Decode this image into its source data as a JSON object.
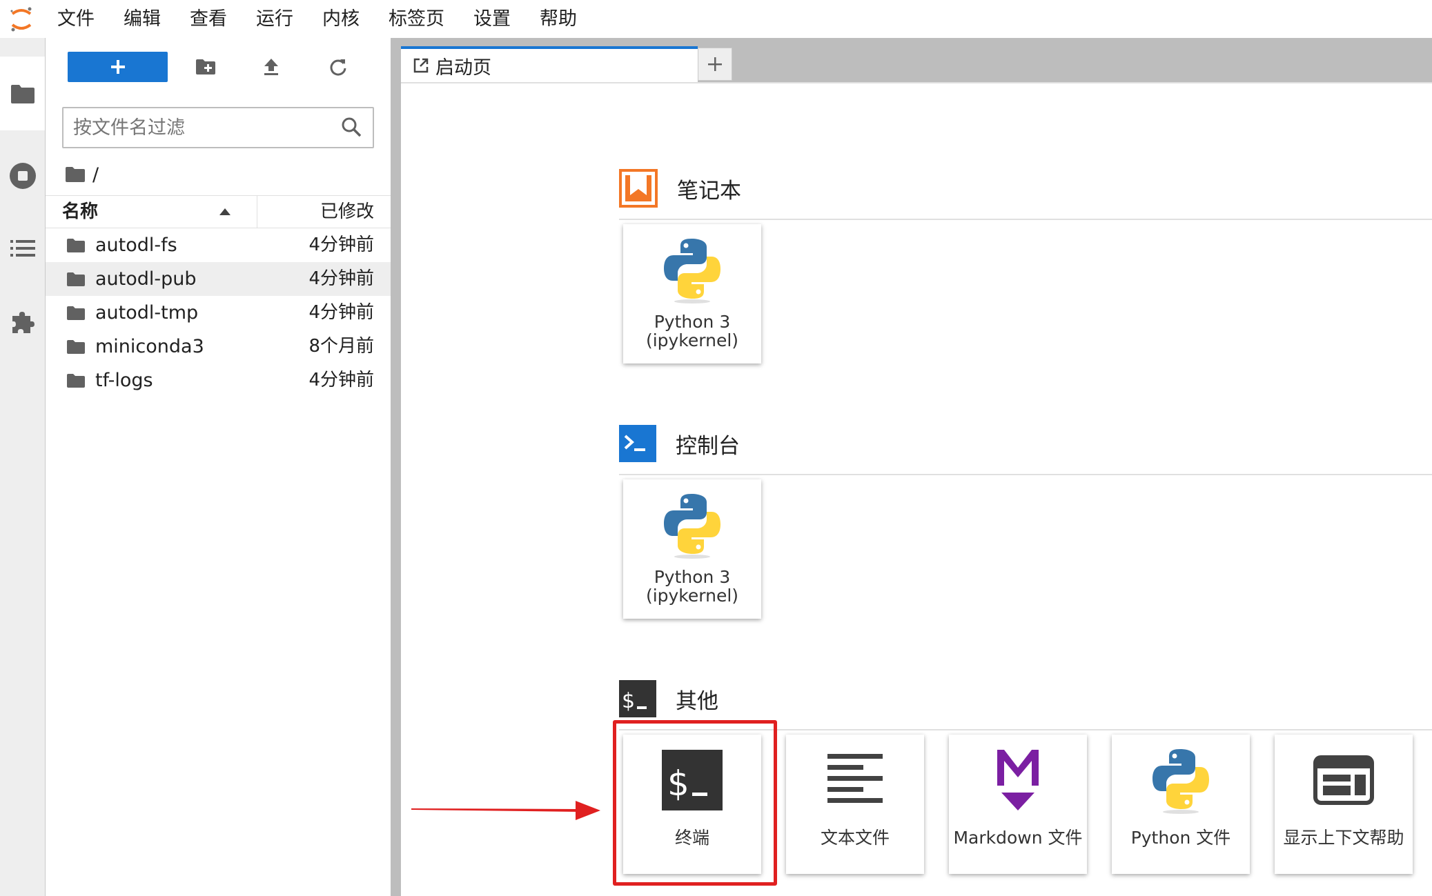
{
  "menubar": {
    "items": [
      "文件",
      "编辑",
      "查看",
      "运行",
      "内核",
      "标签页",
      "设置",
      "帮助"
    ]
  },
  "activity": {
    "icons": [
      "folder-icon",
      "stop-circle-icon",
      "list-icon",
      "puzzle-icon"
    ]
  },
  "filebrowser": {
    "filter_placeholder": "按文件名过滤",
    "breadcrumb": "/",
    "columns": {
      "name": "名称",
      "modified": "已修改"
    },
    "files": [
      {
        "name": "autodl-fs",
        "modified": "4分钟前"
      },
      {
        "name": "autodl-pub",
        "modified": "4分钟前"
      },
      {
        "name": "autodl-tmp",
        "modified": "4分钟前"
      },
      {
        "name": "miniconda3",
        "modified": "8个月前"
      },
      {
        "name": "tf-logs",
        "modified": "4分钟前"
      }
    ],
    "selected_index": 1
  },
  "tabs": {
    "launcher_label": "启动页",
    "add_label": "+"
  },
  "launcher": {
    "notebook": {
      "title": "笔记本",
      "cards": [
        {
          "line1": "Python 3",
          "line2": "(ipykernel)"
        }
      ]
    },
    "console": {
      "title": "控制台",
      "cards": [
        {
          "line1": "Python 3",
          "line2": "(ipykernel)"
        }
      ]
    },
    "other": {
      "title": "其他",
      "cards": [
        {
          "label": "终端",
          "icon": "terminal-icon"
        },
        {
          "label": "文本文件",
          "icon": "text-file-icon"
        },
        {
          "label": "Markdown 文件",
          "icon": "markdown-icon"
        },
        {
          "label": "Python 文件",
          "icon": "python-icon"
        },
        {
          "label": "显示上下文帮助",
          "icon": "context-help-icon"
        }
      ]
    }
  },
  "colors": {
    "accent": "#1976d2",
    "notebook_orange": "#f37726",
    "markdown_purple": "#7b1fa2",
    "annotation_red": "#e02020"
  }
}
